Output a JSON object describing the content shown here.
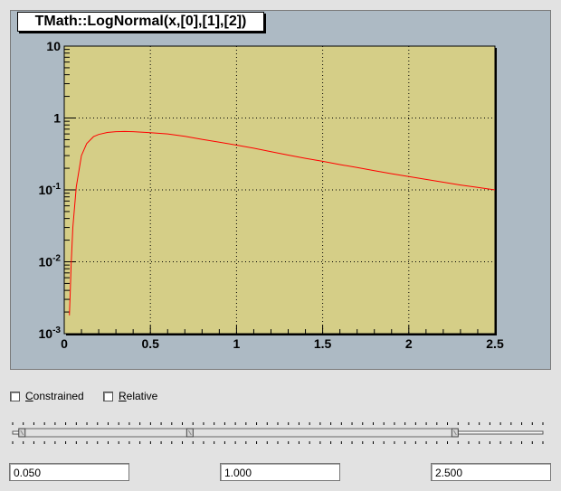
{
  "canvas": {
    "title": "TMath::LogNormal(x,[0],[1],[2])",
    "colors": {
      "frame_bg": "#adbac4",
      "plot_bg": "#d5ce87",
      "curve": "#ff0000",
      "grid": "#000000"
    }
  },
  "chart_data": {
    "type": "line",
    "title": "TMath::LogNormal(x,[0],[1],[2])",
    "xlabel": "",
    "ylabel": "",
    "xlim": [
      0,
      2.5
    ],
    "ylim": [
      0.001,
      10
    ],
    "yscale": "log",
    "grid": true,
    "x_ticks": [
      "0",
      "0.5",
      "1",
      "1.5",
      "2",
      "2.5"
    ],
    "y_ticks": [
      {
        "base": "10",
        "exp": "-3",
        "value": 0.001
      },
      {
        "base": "10",
        "exp": "-2",
        "value": 0.01
      },
      {
        "base": "10",
        "exp": "-1",
        "value": 0.1
      },
      {
        "base": "1",
        "exp": "",
        "value": 1
      },
      {
        "base": "10",
        "exp": "",
        "value": 10
      }
    ],
    "series": [
      {
        "color": "#ff0000",
        "x": [
          0.03,
          0.035,
          0.04,
          0.05,
          0.07,
          0.1,
          0.13,
          0.17,
          0.2,
          0.25,
          0.3,
          0.35,
          0.4,
          0.5,
          0.6,
          0.7,
          0.8,
          0.9,
          1.0,
          1.1,
          1.2,
          1.3,
          1.4,
          1.5,
          1.6,
          1.7,
          1.8,
          1.9,
          2.0,
          2.1,
          2.2,
          2.3,
          2.4,
          2.5
        ],
        "y": [
          0.0018,
          0.004,
          0.009,
          0.03,
          0.11,
          0.3,
          0.44,
          0.55,
          0.59,
          0.63,
          0.645,
          0.65,
          0.645,
          0.625,
          0.6,
          0.555,
          0.505,
          0.46,
          0.42,
          0.38,
          0.34,
          0.305,
          0.275,
          0.25,
          0.225,
          0.205,
          0.185,
          0.168,
          0.153,
          0.14,
          0.128,
          0.117,
          0.108,
          0.1
        ]
      }
    ]
  },
  "options": {
    "constrained_label_first": "C",
    "constrained_label_rest": "onstrained",
    "constrained_checked": false,
    "relative_label_first": "R",
    "relative_label_rest": "elative",
    "relative_checked": false
  },
  "slider": {
    "min": 0.05,
    "value": 1.0,
    "max": 2.5,
    "range_max": 3.0
  },
  "fields": {
    "min_value": "0.050",
    "mid_value": "1.000",
    "max_value": "2.500"
  }
}
